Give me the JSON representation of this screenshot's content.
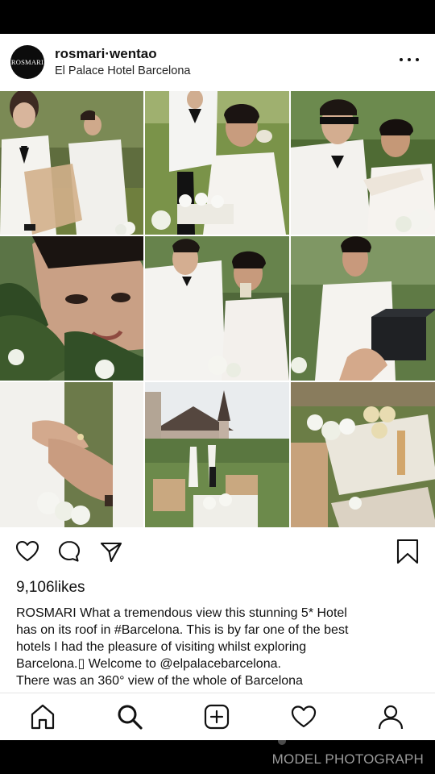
{
  "post": {
    "avatar_text": "ROSMARI",
    "username": "rosmari·wentao",
    "location": "El Palace Hotel Barcelona"
  },
  "engagement": {
    "likes": "9,106likes"
  },
  "caption": {
    "user": "ROSMARI",
    "line1_text": "What a tremendous view this stunning 5* Hotel",
    "line2": "has on its roof in #Barcelona. This is by far one of the best",
    "line3": "hotels I had the pleasure of visiting whilst exploring",
    "line4": "Barcelona.▯ Welcome to @elpalacebarcelona.",
    "line5": "There was an 360° view of the whole of Barcelona"
  },
  "grid": {
    "photos": [
      {
        "subject": "groom and bride in white standing on lawn"
      },
      {
        "subject": "bride holding champagne glass with groom behind"
      },
      {
        "subject": "blindfolded groom and laughing bride"
      },
      {
        "subject": "close-up of bride's face behind leaves"
      },
      {
        "subject": "groom embracing bride, bride sipping drink"
      },
      {
        "subject": "bride surprised, hand offering black box"
      },
      {
        "subject": "close-up of hands with wedding ring"
      },
      {
        "subject": "couple walking toward chateau with table"
      },
      {
        "subject": "champagne glasses and flowers on tray"
      }
    ]
  },
  "icons": {
    "action_bar": [
      "heart-icon",
      "comment-icon",
      "share-icon",
      "bookmark-icon"
    ],
    "nav": [
      "home-icon",
      "search-icon",
      "add-icon",
      "activity-icon",
      "profile-icon"
    ]
  },
  "watermark": "MODEL PHOTOGRAPH",
  "colors": {
    "text": "#111111",
    "background": "#ffffff",
    "chrome": "#000000",
    "watermark": "#9a9a9a"
  }
}
